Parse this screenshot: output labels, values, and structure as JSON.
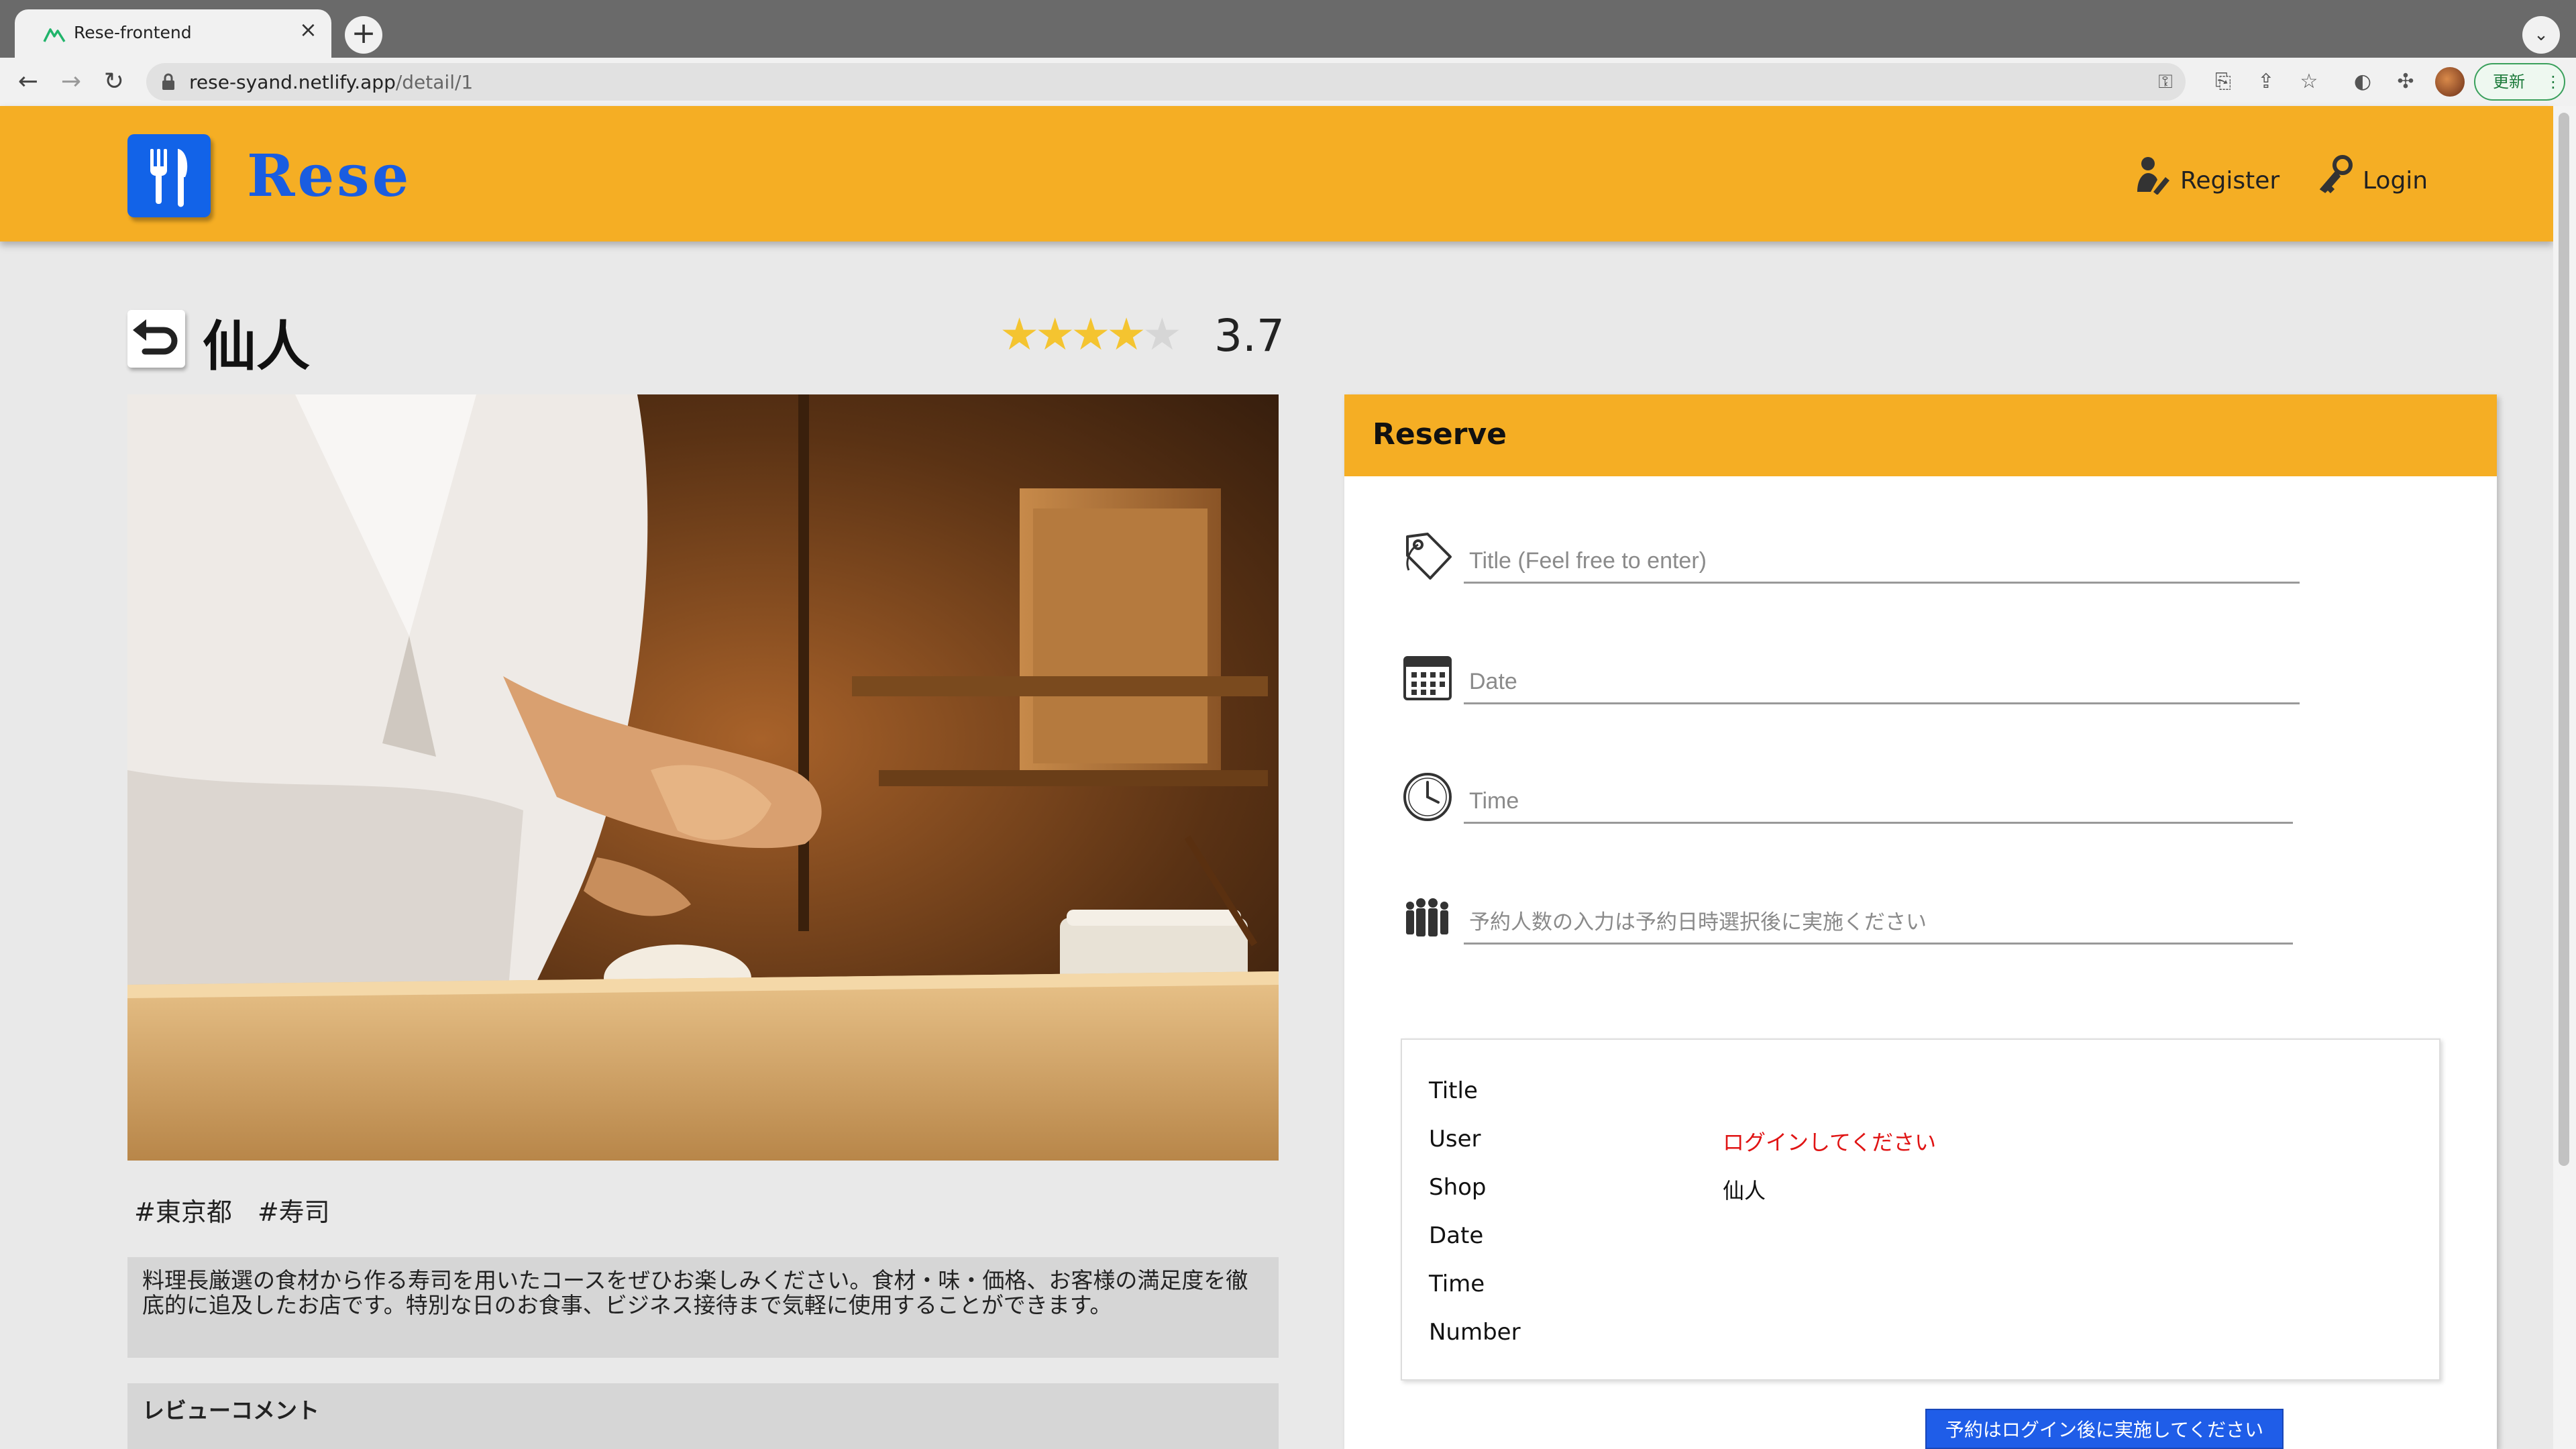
{
  "browser": {
    "tab_title": "Rese-frontend",
    "tab_close": "×",
    "new_tab": "+",
    "url_host": "rese-syand.netlify.app",
    "url_path": "/detail/1",
    "update_label": "更新"
  },
  "header": {
    "logo_text": "Rese",
    "register_label": "Register",
    "login_label": "Login"
  },
  "shop": {
    "name": "仙人",
    "rating": "3.7",
    "rating_value": 3.7,
    "rating_max": 5,
    "tags": "#東京都　#寿司",
    "description": "料理長厳選の食材から作る寿司を用いたコースをぜひお楽しみください。食材・味・価格、お客様の満足度を徹底的に追及したお店です。特別な日のお食事、ビジネス接待まで気軽に使用することができます。",
    "review_heading": "レビューコメント"
  },
  "reserve": {
    "title": "Reserve",
    "title_placeholder": "Title (Feel free to enter)",
    "date_placeholder": "Date",
    "time_placeholder": "Time",
    "number_placeholder": "予約人数の入力は予約日時選択後に実施ください",
    "summary": {
      "title_label": "Title",
      "user_label": "User",
      "user_value": "ログインしてください",
      "shop_label": "Shop",
      "shop_value": "仙人",
      "date_label": "Date",
      "time_label": "Time",
      "number_label": "Number"
    },
    "submit_label": "予約はログイン後に実施してください"
  },
  "colors": {
    "header": "#f5ae24",
    "brand_blue": "#1263e8",
    "star": "#f4c430",
    "warning": "#e01414",
    "submit": "#1f5de8"
  },
  "icons": [
    "rese-logo-icon",
    "register-icon",
    "login-key-icon",
    "back-arrow-icon",
    "tag-icon",
    "calendar-icon",
    "clock-icon",
    "people-icon"
  ]
}
